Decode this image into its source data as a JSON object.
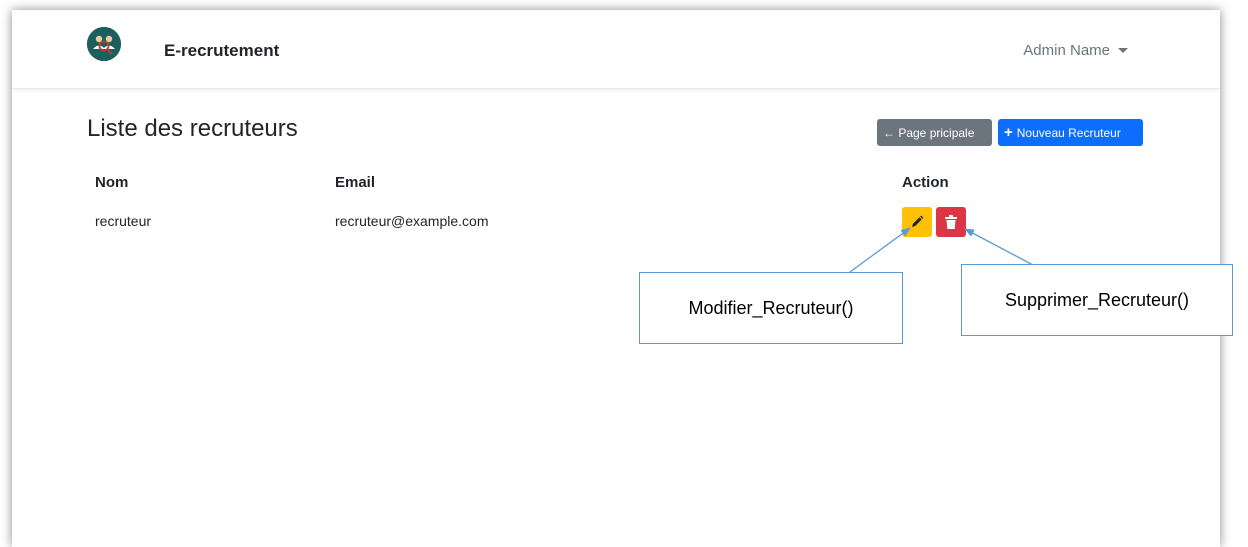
{
  "app": {
    "brand": "E-recrutement",
    "logo_icon": "recruiter-logo-icon",
    "user_name": "Admin Name"
  },
  "page": {
    "title": "Liste des recruteurs",
    "back_button": "← Page pricipale",
    "new_button_icon": "+",
    "new_button": "Nouveau Recruteur"
  },
  "table": {
    "headers": {
      "name": "Nom",
      "email": "Email",
      "action": "Action"
    },
    "rows": [
      {
        "name": "recruteur",
        "email": "recruteur@example.com"
      }
    ]
  },
  "annotations": {
    "edit": "Modifier_Recruteur()",
    "delete": "Supprimer_Recruteur()"
  },
  "colors": {
    "primary": "#0d6efd",
    "secondary": "#6c757d",
    "warning": "#ffc107",
    "danger": "#dc3545",
    "logo": "#1d5f5c",
    "callout_border": "#5b9bd5"
  }
}
